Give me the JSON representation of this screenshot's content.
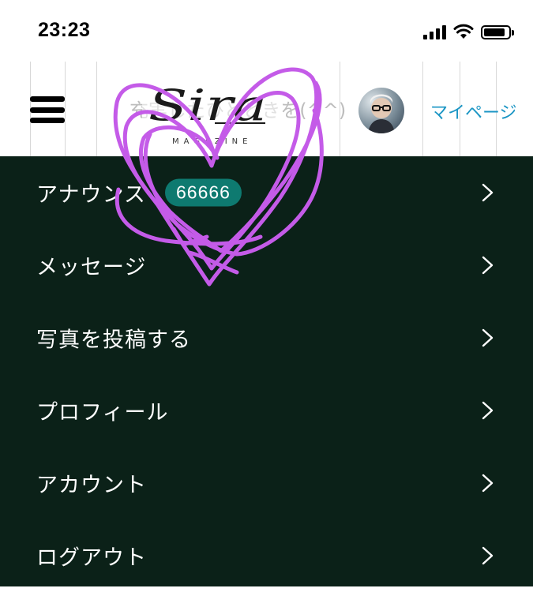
{
  "status_bar": {
    "time": "23:23",
    "battery_level": 0.85
  },
  "header": {
    "search_placeholder": "充実したひとときを(^^)",
    "logo_text": "Sira",
    "logo_subtext": "MAGAZINE",
    "mypage_label": "マイページ"
  },
  "menu": {
    "items": [
      {
        "label": "アナウンス",
        "badge": "66666"
      },
      {
        "label": "メッセージ"
      },
      {
        "label": "写真を投稿する"
      },
      {
        "label": "プロフィール"
      },
      {
        "label": "アカウント"
      },
      {
        "label": "ログアウト"
      }
    ]
  },
  "colors": {
    "menu_background": "#0b2118",
    "badge_background": "#0e7a70",
    "link": "#1a95c4",
    "scribble": "#c45be8"
  }
}
